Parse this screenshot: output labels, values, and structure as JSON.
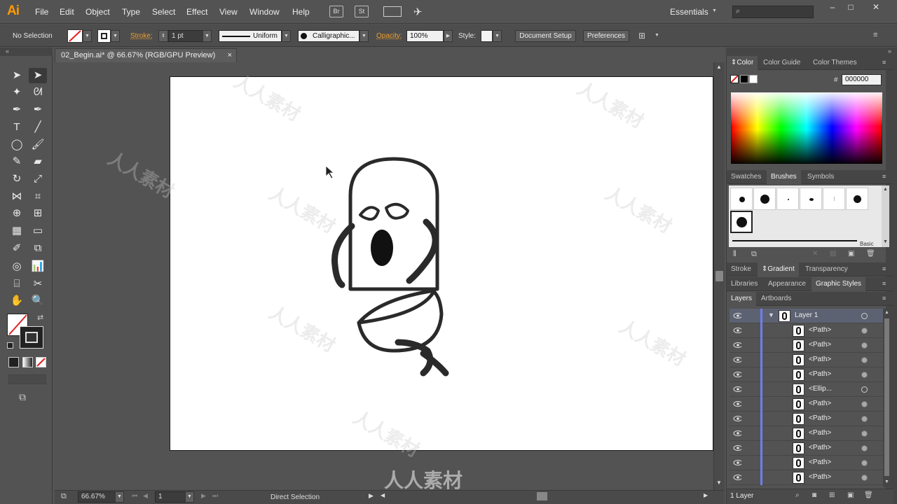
{
  "app": {
    "logo": "Ai",
    "menus": [
      "File",
      "Edit",
      "Object",
      "Type",
      "Select",
      "Effect",
      "View",
      "Window",
      "Help"
    ],
    "bridge_label": "Br",
    "stock_label": "St",
    "workspace": "Essentials",
    "window_buttons": [
      "–",
      "□",
      "✕"
    ]
  },
  "control": {
    "selection_status": "No Selection",
    "stroke_label": "Stroke:",
    "stroke_weight": "1 pt",
    "profile": "Uniform",
    "brush": "Calligraphic...",
    "opacity_label": "Opacity:",
    "opacity": "100%",
    "style_label": "Style:",
    "document_setup": "Document Setup",
    "preferences": "Preferences"
  },
  "document": {
    "tab_title": "02_Begin.ai* @ 66.67% (RGB/GPU Preview)",
    "close_glyph": "×"
  },
  "status": {
    "zoom": "66.67%",
    "artboard_number": "1",
    "tool_name": "Direct Selection"
  },
  "panels": {
    "color_tabs": [
      "Color",
      "Color Guide",
      "Color Themes"
    ],
    "hex_label": "#",
    "hex_value": "000000",
    "brush_tabs": [
      "Swatches",
      "Brushes",
      "Symbols"
    ],
    "brush_library_label": "Basic",
    "stroke_tabs": [
      "Stroke",
      "Gradient",
      "Transparency"
    ],
    "style_tabs": [
      "Libraries",
      "Appearance",
      "Graphic Styles"
    ],
    "layer_tabs": [
      "Layers",
      "Artboards"
    ],
    "layers_footer": "1 Layer",
    "layers": [
      {
        "name": "Layer 1",
        "kind": "layer"
      },
      {
        "name": "<Path>",
        "kind": "item"
      },
      {
        "name": "<Path>",
        "kind": "item"
      },
      {
        "name": "<Path>",
        "kind": "item"
      },
      {
        "name": "<Path>",
        "kind": "item"
      },
      {
        "name": "<Ellip...",
        "kind": "item"
      },
      {
        "name": "<Path>",
        "kind": "item"
      },
      {
        "name": "<Path>",
        "kind": "item"
      },
      {
        "name": "<Path>",
        "kind": "item"
      },
      {
        "name": "<Path>",
        "kind": "item"
      },
      {
        "name": "<Path>",
        "kind": "item"
      },
      {
        "name": "<Path>",
        "kind": "item"
      }
    ]
  },
  "watermark": "人人素材",
  "colors": {
    "ui_bg": "#535353",
    "accent_orange": "#ff9a00",
    "layer_color": "#6d7ff0",
    "artboard": "#ffffff",
    "artwork_stroke": "#2a2a2a"
  }
}
